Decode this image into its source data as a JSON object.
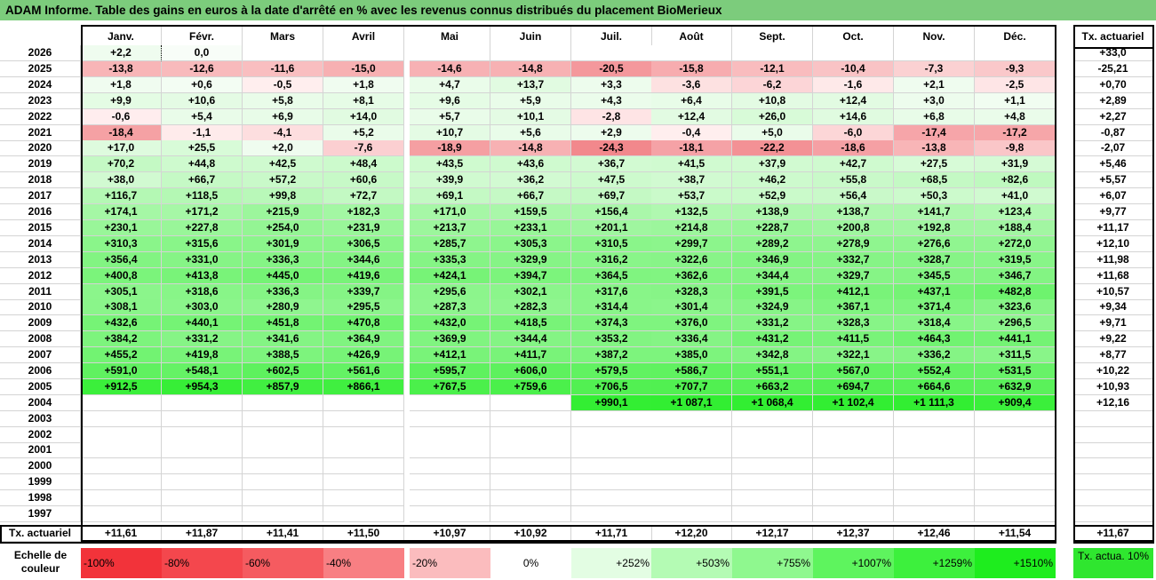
{
  "title": "ADAM Informe. Table des gains en euros à la date d'arrêté en % avec les revenus connus distribués du placement BioMerieux",
  "months": [
    "Janv.",
    "Févr.",
    "Mars",
    "Avril",
    "Mai",
    "Juin",
    "Juil.",
    "Août",
    "Sept.",
    "Oct.",
    "Nov.",
    "Déc."
  ],
  "annual_header": "Tx. actuariel",
  "rows": [
    {
      "year": "2026",
      "values": [
        "+2,2",
        "0,0",
        "",
        "",
        "",
        "",
        "",
        "",
        "",
        "",
        "",
        ""
      ],
      "annual": "+33,0"
    },
    {
      "year": "2025",
      "values": [
        "-13,8",
        "-12,6",
        "-11,6",
        "-15,0",
        "-14,6",
        "-14,8",
        "-20,5",
        "-15,8",
        "-12,1",
        "-10,4",
        "-7,3",
        "-9,3"
      ],
      "annual": "-25,21"
    },
    {
      "year": "2024",
      "values": [
        "+1,8",
        "+0,6",
        "-0,5",
        "+1,8",
        "+4,7",
        "+13,7",
        "+3,3",
        "-3,6",
        "-6,2",
        "-1,6",
        "+2,1",
        "-2,5"
      ],
      "annual": "+0,70"
    },
    {
      "year": "2023",
      "values": [
        "+9,9",
        "+10,6",
        "+5,8",
        "+8,1",
        "+9,6",
        "+5,9",
        "+4,3",
        "+6,4",
        "+10,8",
        "+12,4",
        "+3,0",
        "+1,1"
      ],
      "annual": "+2,89"
    },
    {
      "year": "2022",
      "values": [
        "-0,6",
        "+5,4",
        "+6,9",
        "+14,0",
        "+5,7",
        "+10,1",
        "-2,8",
        "+12,4",
        "+26,0",
        "+14,6",
        "+6,8",
        "+4,8"
      ],
      "annual": "+2,27"
    },
    {
      "year": "2021",
      "values": [
        "-18,4",
        "-1,1",
        "-4,1",
        "+5,2",
        "+10,7",
        "+5,6",
        "+2,9",
        "-0,4",
        "+5,0",
        "-6,0",
        "-17,4",
        "-17,2"
      ],
      "annual": "-0,87"
    },
    {
      "year": "2020",
      "values": [
        "+17,0",
        "+25,5",
        "+2,0",
        "-7,6",
        "-18,9",
        "-14,8",
        "-24,3",
        "-18,1",
        "-22,2",
        "-18,6",
        "-13,8",
        "-9,8"
      ],
      "annual": "-2,07"
    },
    {
      "year": "2019",
      "values": [
        "+70,2",
        "+44,8",
        "+42,5",
        "+48,4",
        "+43,5",
        "+43,6",
        "+36,7",
        "+41,5",
        "+37,9",
        "+42,7",
        "+27,5",
        "+31,9"
      ],
      "annual": "+5,46"
    },
    {
      "year": "2018",
      "values": [
        "+38,0",
        "+66,7",
        "+57,2",
        "+60,6",
        "+39,9",
        "+36,2",
        "+47,5",
        "+38,7",
        "+46,2",
        "+55,8",
        "+68,5",
        "+82,6"
      ],
      "annual": "+5,57"
    },
    {
      "year": "2017",
      "values": [
        "+116,7",
        "+118,5",
        "+99,8",
        "+72,7",
        "+69,1",
        "+66,7",
        "+69,7",
        "+53,7",
        "+52,9",
        "+56,4",
        "+50,3",
        "+41,0"
      ],
      "annual": "+6,07"
    },
    {
      "year": "2016",
      "values": [
        "+174,1",
        "+171,2",
        "+215,9",
        "+182,3",
        "+171,0",
        "+159,5",
        "+156,4",
        "+132,5",
        "+138,9",
        "+138,7",
        "+141,7",
        "+123,4"
      ],
      "annual": "+9,77"
    },
    {
      "year": "2015",
      "values": [
        "+230,1",
        "+227,8",
        "+254,0",
        "+231,9",
        "+213,7",
        "+233,1",
        "+201,1",
        "+214,8",
        "+228,7",
        "+200,8",
        "+192,8",
        "+188,4"
      ],
      "annual": "+11,17"
    },
    {
      "year": "2014",
      "values": [
        "+310,3",
        "+315,6",
        "+301,9",
        "+306,5",
        "+285,7",
        "+305,3",
        "+310,5",
        "+299,7",
        "+289,2",
        "+278,9",
        "+276,6",
        "+272,0"
      ],
      "annual": "+12,10"
    },
    {
      "year": "2013",
      "values": [
        "+356,4",
        "+331,0",
        "+336,3",
        "+344,6",
        "+335,3",
        "+329,9",
        "+316,2",
        "+322,6",
        "+346,9",
        "+332,7",
        "+328,7",
        "+319,5"
      ],
      "annual": "+11,98"
    },
    {
      "year": "2012",
      "values": [
        "+400,8",
        "+413,8",
        "+445,0",
        "+419,6",
        "+424,1",
        "+394,7",
        "+364,5",
        "+362,6",
        "+344,4",
        "+329,7",
        "+345,5",
        "+346,7"
      ],
      "annual": "+11,68"
    },
    {
      "year": "2011",
      "values": [
        "+305,1",
        "+318,6",
        "+336,3",
        "+339,7",
        "+295,6",
        "+302,1",
        "+317,6",
        "+328,3",
        "+391,5",
        "+412,1",
        "+437,1",
        "+482,8"
      ],
      "annual": "+10,57"
    },
    {
      "year": "2010",
      "values": [
        "+308,1",
        "+303,0",
        "+280,9",
        "+295,5",
        "+287,3",
        "+282,3",
        "+314,4",
        "+301,4",
        "+324,9",
        "+367,1",
        "+371,4",
        "+323,6"
      ],
      "annual": "+9,34"
    },
    {
      "year": "2009",
      "values": [
        "+432,6",
        "+440,1",
        "+451,8",
        "+470,8",
        "+432,0",
        "+418,5",
        "+374,3",
        "+376,0",
        "+331,2",
        "+328,3",
        "+318,4",
        "+296,5"
      ],
      "annual": "+9,71"
    },
    {
      "year": "2008",
      "values": [
        "+384,2",
        "+331,2",
        "+341,6",
        "+364,9",
        "+369,9",
        "+344,4",
        "+353,2",
        "+336,4",
        "+431,2",
        "+411,5",
        "+464,3",
        "+441,1"
      ],
      "annual": "+9,22"
    },
    {
      "year": "2007",
      "values": [
        "+455,2",
        "+419,8",
        "+388,5",
        "+426,9",
        "+412,1",
        "+411,7",
        "+387,2",
        "+385,0",
        "+342,8",
        "+322,1",
        "+336,2",
        "+311,5"
      ],
      "annual": "+8,77"
    },
    {
      "year": "2006",
      "values": [
        "+591,0",
        "+548,1",
        "+602,5",
        "+561,6",
        "+595,7",
        "+606,0",
        "+579,5",
        "+586,7",
        "+551,1",
        "+567,0",
        "+552,4",
        "+531,5"
      ],
      "annual": "+10,22"
    },
    {
      "year": "2005",
      "values": [
        "+912,5",
        "+954,3",
        "+857,9",
        "+866,1",
        "+767,5",
        "+759,6",
        "+706,5",
        "+707,7",
        "+663,2",
        "+694,7",
        "+664,6",
        "+632,9"
      ],
      "annual": "+10,93"
    },
    {
      "year": "2004",
      "values": [
        "",
        "",
        "",
        "",
        "",
        "",
        "+990,1",
        "+1 087,1",
        "+1 068,4",
        "+1 102,4",
        "+1 111,3",
        "+909,4"
      ],
      "annual": "+12,16"
    },
    {
      "year": "2003",
      "values": [
        "",
        "",
        "",
        "",
        "",
        "",
        "",
        "",
        "",
        "",
        "",
        ""
      ],
      "annual": ""
    },
    {
      "year": "2002",
      "values": [
        "",
        "",
        "",
        "",
        "",
        "",
        "",
        "",
        "",
        "",
        "",
        ""
      ],
      "annual": ""
    },
    {
      "year": "2001",
      "values": [
        "",
        "",
        "",
        "",
        "",
        "",
        "",
        "",
        "",
        "",
        "",
        ""
      ],
      "annual": ""
    },
    {
      "year": "2000",
      "values": [
        "",
        "",
        "",
        "",
        "",
        "",
        "",
        "",
        "",
        "",
        "",
        ""
      ],
      "annual": ""
    },
    {
      "year": "1999",
      "values": [
        "",
        "",
        "",
        "",
        "",
        "",
        "",
        "",
        "",
        "",
        "",
        ""
      ],
      "annual": ""
    },
    {
      "year": "1998",
      "values": [
        "",
        "",
        "",
        "",
        "",
        "",
        "",
        "",
        "",
        "",
        "",
        ""
      ],
      "annual": ""
    },
    {
      "year": "1997",
      "values": [
        "",
        "",
        "",
        "",
        "",
        "",
        "",
        "",
        "",
        "",
        "",
        ""
      ],
      "annual": ""
    }
  ],
  "footer": {
    "label": "Tx. actuariel",
    "values": [
      "+11,61",
      "+11,87",
      "+11,41",
      "+11,50",
      "+10,97",
      "+10,92",
      "+11,71",
      "+12,20",
      "+12,17",
      "+12,37",
      "+12,46",
      "+11,54"
    ],
    "annual": "+11,67"
  },
  "scale": {
    "label": "Echelle de couleur",
    "items": [
      {
        "text": "-100%",
        "color": "#f2333a"
      },
      {
        "text": "-80%",
        "color": "#f4474d"
      },
      {
        "text": "-60%",
        "color": "#f55b60"
      },
      {
        "text": "-40%",
        "color": "#f87f83"
      },
      {
        "text": "-20%",
        "color": "#fbbcbe"
      },
      {
        "text": "0%",
        "color": "#ffffff"
      },
      {
        "text": "+252%",
        "color": "#e3fde3"
      },
      {
        "text": "+503%",
        "color": "#b4fbb4"
      },
      {
        "text": "+755%",
        "color": "#8ff88f"
      },
      {
        "text": "+1007%",
        "color": "#5ef45e"
      },
      {
        "text": "+1259%",
        "color": "#3df03d"
      },
      {
        "text": "+1510%",
        "color": "#1eed1e"
      }
    ],
    "annual_text": "Tx. actua. 10%",
    "annual_color": "#2fe62f"
  }
}
